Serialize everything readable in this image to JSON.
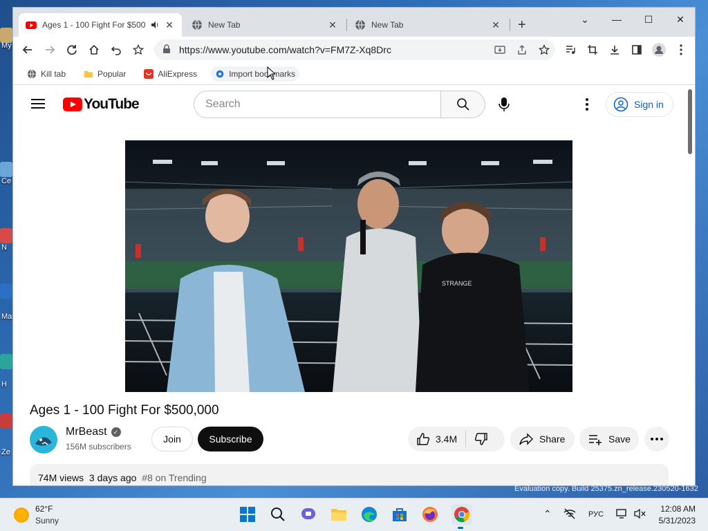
{
  "desktop": {
    "labels": [
      "My",
      "Ce",
      "N",
      "Ma",
      "H",
      "Ze"
    ]
  },
  "browser": {
    "tabs": [
      {
        "title": "Ages 1 - 100 Fight For $500",
        "active": true,
        "favicon": "youtube-icon",
        "audio": true
      },
      {
        "title": "New Tab",
        "active": false,
        "favicon": "globe-icon"
      },
      {
        "title": "New Tab",
        "active": false,
        "favicon": "globe-icon"
      }
    ],
    "url": "https://www.youtube.com/watch?v=FM7Z-Xq8Drc",
    "bookmarks": [
      {
        "label": "Kill tab",
        "icon": "globe-icon"
      },
      {
        "label": "Popular",
        "icon": "folder-icon"
      },
      {
        "label": "AliExpress",
        "icon": "aliexpress-icon"
      },
      {
        "label": "Import bookmarks",
        "icon": "import-icon"
      }
    ]
  },
  "youtube": {
    "logo_text": "YouTube",
    "search_placeholder": "Search",
    "signin_label": "Sign in",
    "video_title": "Ages 1 - 100 Fight For $500,000",
    "channel_name": "MrBeast",
    "subscribers": "156M subscribers",
    "join_label": "Join",
    "subscribe_label": "Subscribe",
    "likes": "3.4M",
    "share_label": "Share",
    "save_label": "Save",
    "views": "74M views",
    "age": "3 days ago",
    "trending": "#8 on Trending",
    "video_shirt_text": "STRANGE"
  },
  "watermark": "Evaluation copy. Build 25375.zn_release.230520-1632",
  "taskbar": {
    "temperature": "62°F",
    "condition": "Sunny",
    "language": "РУС",
    "time": "12:08 AM",
    "date": "5/31/2023"
  },
  "colors": {
    "youtube_red": "#ff0000",
    "link_blue": "#065fd4",
    "chrome_tabstrip": "#dee1e6"
  }
}
